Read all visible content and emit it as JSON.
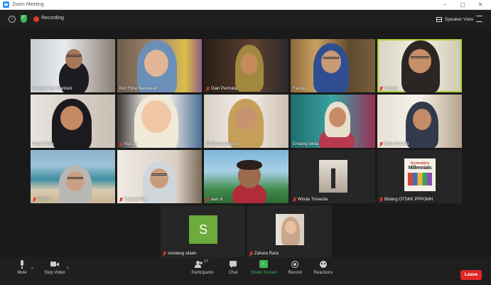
{
  "window": {
    "title": "Zoom Meeting",
    "controls": [
      "–",
      "▢",
      "✕"
    ]
  },
  "topbar": {
    "recording_label": "Recording",
    "speaker_view_label": "Speaker View"
  },
  "participants": [
    {
      "name": "Puspita Ayu Wardani",
      "muted": false
    },
    {
      "name": "Nur Fitria Saraswati",
      "muted": false
    },
    {
      "name": "Dian Permata",
      "muted": true
    },
    {
      "name": "Farida",
      "muted": false
    },
    {
      "name": "Yuttina",
      "muted": true
    },
    {
      "name": "Dona Feria",
      "muted": false
    },
    {
      "name": "Nur..ni",
      "muted": true
    },
    {
      "name": "Sri Purwaningsih",
      "muted": false
    },
    {
      "name": "Endang lukita",
      "muted": false
    },
    {
      "name": "Erita Susanti",
      "muted": true
    },
    {
      "name": "HASTI",
      "muted": true
    },
    {
      "name": "Yulianti Yuli",
      "muted": true
    },
    {
      "name": "aan ul",
      "muted": true
    },
    {
      "name": "Winda Trinanda",
      "muted": true
    },
    {
      "name": "Bidang OTSKK PPPOMN",
      "muted": true
    },
    {
      "name": "sondang silaen",
      "muted": true,
      "avatar_letter": "S"
    },
    {
      "name": "Zahara Rara",
      "muted": true
    }
  ],
  "poster": {
    "line1": "Generation",
    "line2": "Millennials"
  },
  "toolbar": {
    "mute": "Mute",
    "stop_video": "Stop Video",
    "participants": "Participants",
    "participants_count": "17",
    "chat": "Chat",
    "share_screen": "Share Screen",
    "record": "Record",
    "reactions": "Reactions",
    "leave": "Leave"
  },
  "colors": {
    "share_green": "#3cba54",
    "leave_red": "#e02828",
    "speaker_highlight": "#a9d23a",
    "avatar_green": "#6cac3c"
  }
}
